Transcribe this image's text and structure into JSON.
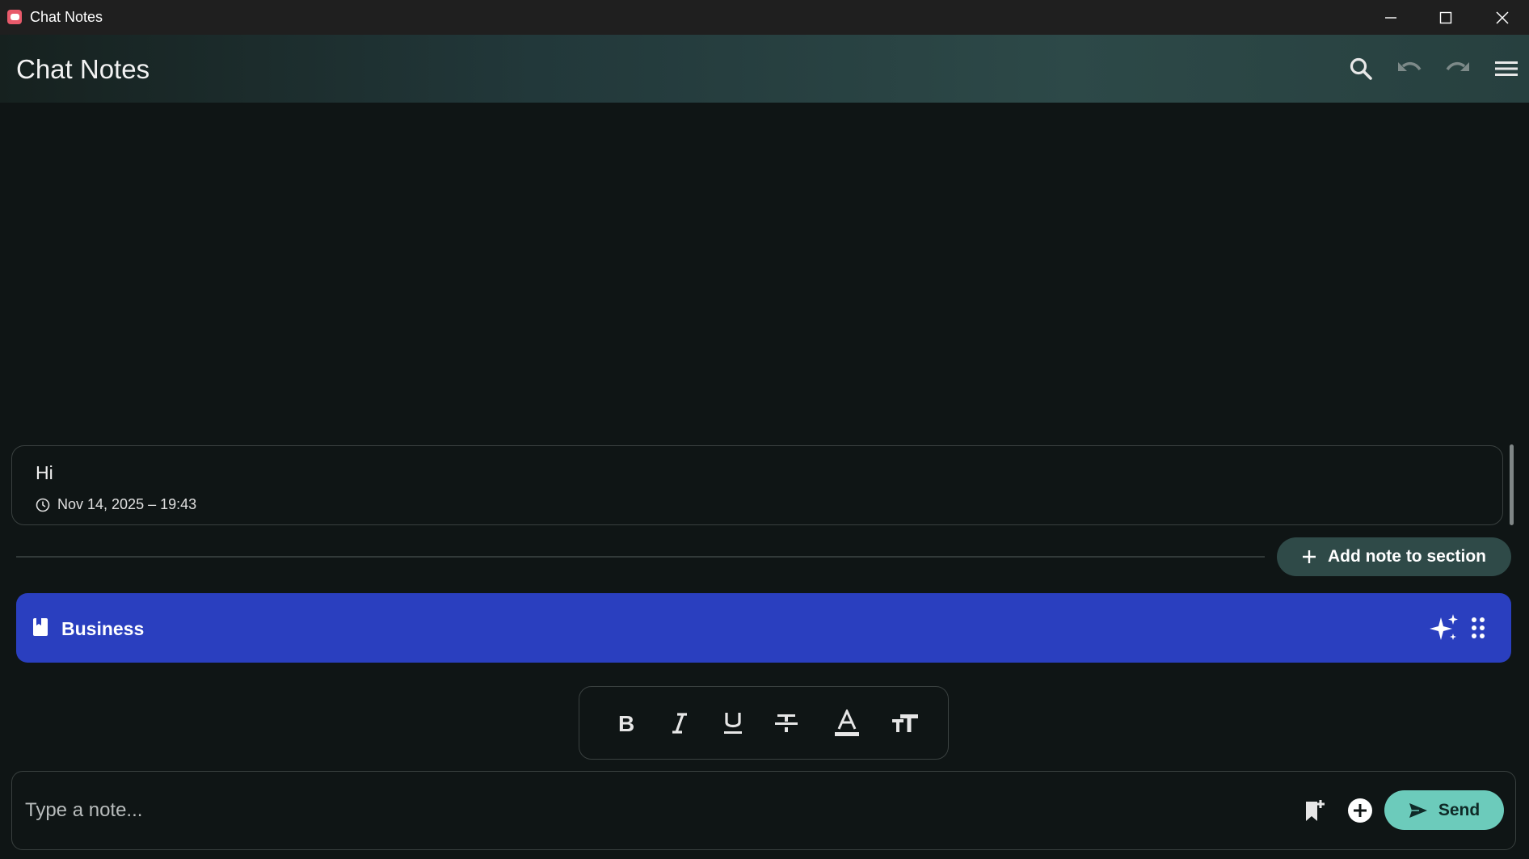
{
  "window": {
    "title": "Chat Notes",
    "controls": [
      "minimize-icon",
      "maximize-icon",
      "close-icon"
    ]
  },
  "header": {
    "title": "Chat Notes",
    "actions": [
      "search-icon",
      "undo-icon",
      "redo-icon",
      "menu-icon"
    ]
  },
  "notes": [
    {
      "text": "Hi",
      "timestamp": "Nov 14, 2025 – 19:43",
      "icon": "clock-icon"
    }
  ],
  "add_note": {
    "label": "Add note to section",
    "icon": "plus-icon"
  },
  "section": {
    "name": "Business",
    "icon": "book-icon",
    "actions": [
      "sparkle-icon",
      "drag-handle-icon"
    ],
    "color": "#2a3fbf"
  },
  "format_toolbar": [
    "bold-icon",
    "italic-icon",
    "underline-icon",
    "strikethrough-icon",
    "text-color-icon",
    "text-size-icon"
  ],
  "composer": {
    "placeholder": "Type a note...",
    "value": "",
    "send_label": "Send",
    "icons": [
      "bookmark-add-icon",
      "add-circle-icon",
      "send-icon"
    ]
  },
  "colors": {
    "background": "#0f1515",
    "accent": "#6ccbbb",
    "add_button": "#2f4a48"
  }
}
